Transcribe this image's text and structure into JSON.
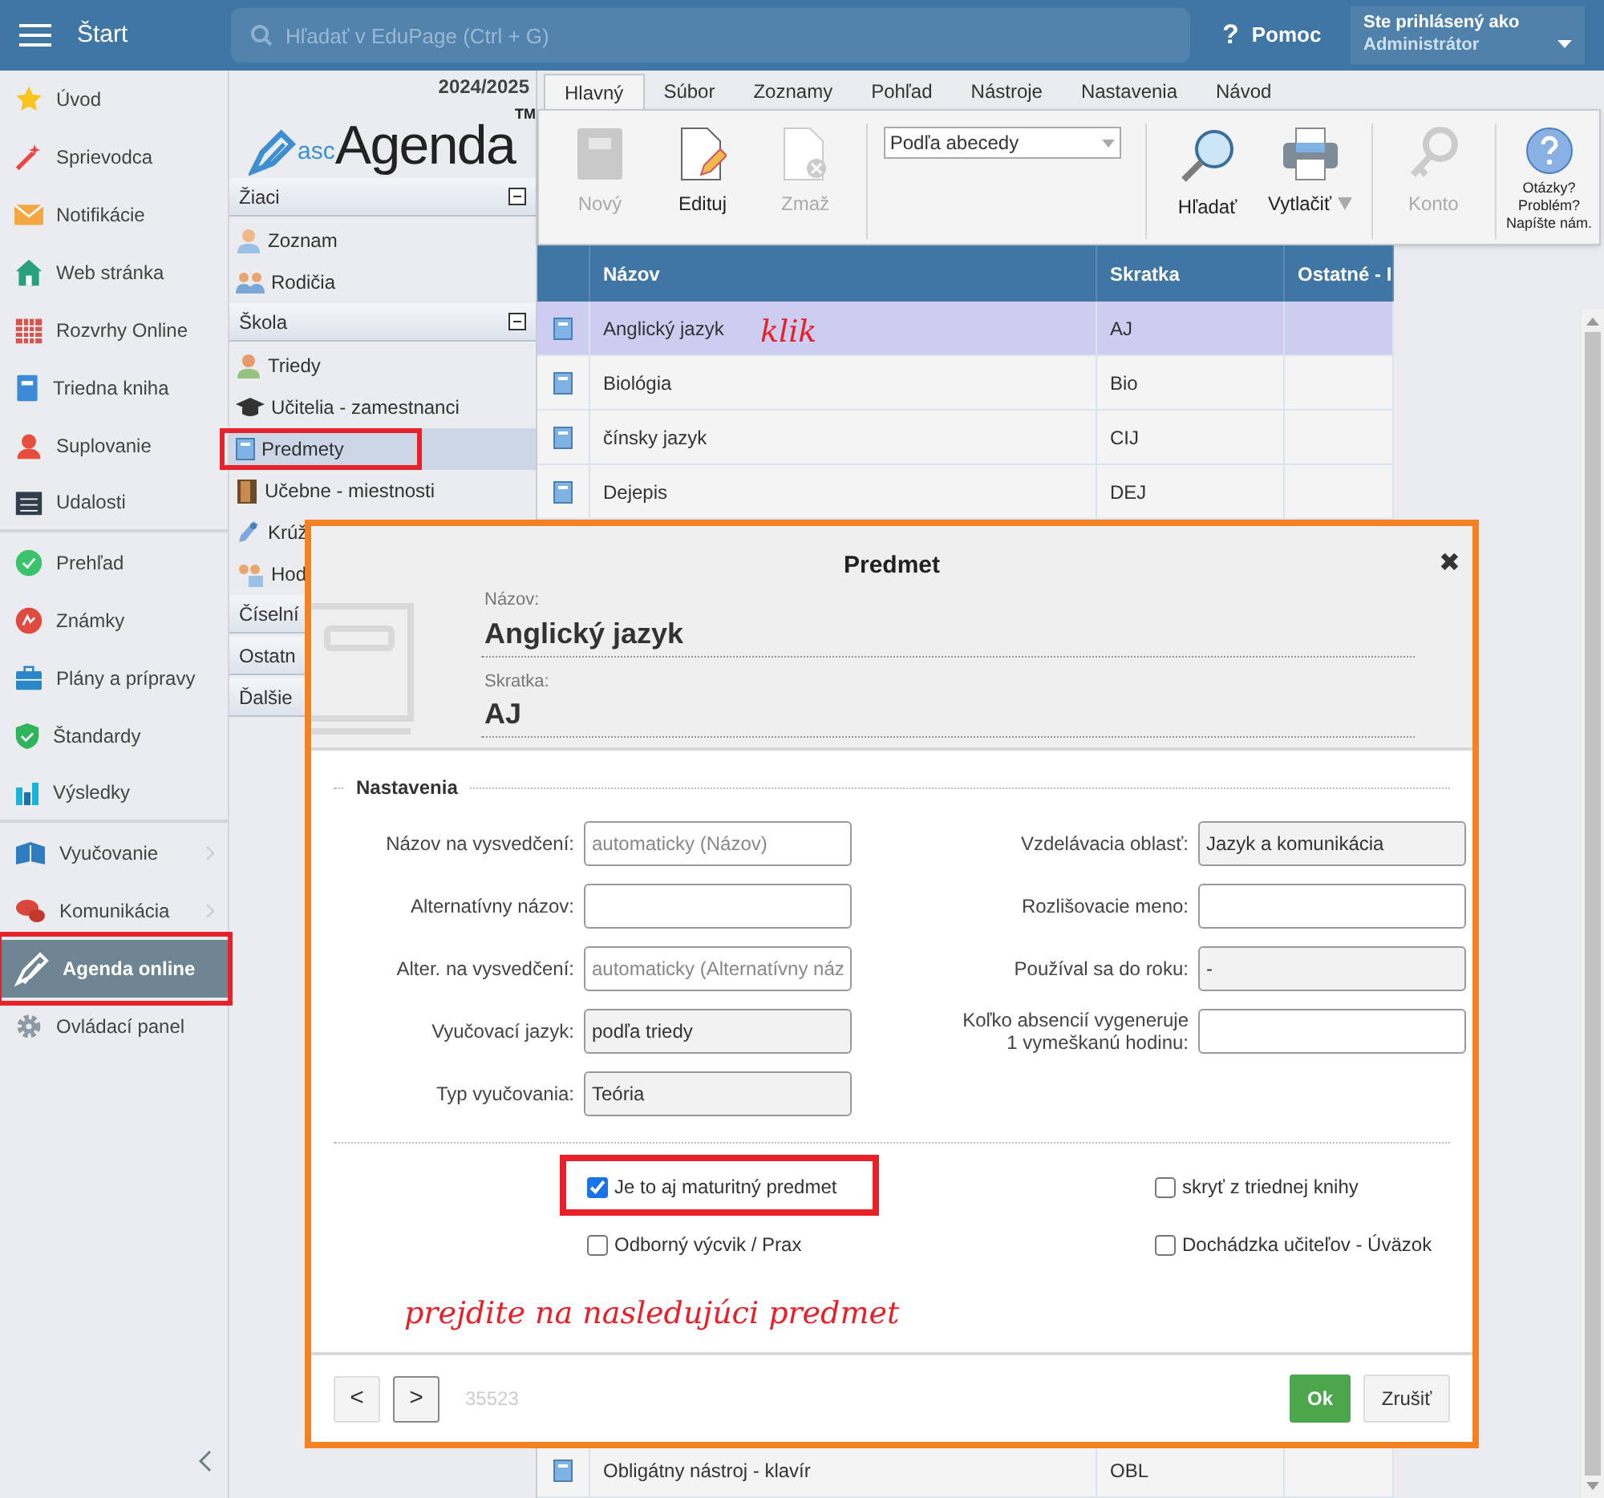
{
  "topbar": {
    "title": "Štart",
    "search": {
      "placeholder": "Hľadať v EduPage (Ctrl + G)"
    },
    "help_icon": "?",
    "help": "Pomoc",
    "user": {
      "caption": "Ste prihlásený ako",
      "name": "Administrátor"
    }
  },
  "sidebar": {
    "items": [
      {
        "label": "Úvod",
        "selected": false,
        "submenu": false
      },
      {
        "label": "Sprievodca",
        "selected": false,
        "submenu": false
      },
      {
        "label": "Notifikácie",
        "selected": false,
        "submenu": false
      },
      {
        "label": "Web stránka",
        "selected": false,
        "submenu": false
      },
      {
        "label": "Rozvrhy Online",
        "selected": false,
        "submenu": false
      },
      {
        "label": "Triedna kniha",
        "selected": false,
        "submenu": false
      },
      {
        "label": "Suplovanie",
        "selected": false,
        "submenu": false
      },
      {
        "label": "Udalosti",
        "selected": false,
        "submenu": false,
        "divider_after": true
      },
      {
        "label": "Prehľad",
        "selected": false,
        "submenu": false
      },
      {
        "label": "Známky",
        "selected": false,
        "submenu": false
      },
      {
        "label": "Plány a prípravy",
        "selected": false,
        "submenu": false
      },
      {
        "label": "Štandardy",
        "selected": false,
        "submenu": false
      },
      {
        "label": "Výsledky",
        "selected": false,
        "submenu": false,
        "divider_after": true
      },
      {
        "label": "Vyučovanie",
        "selected": false,
        "submenu": true
      },
      {
        "label": "Komunikácia",
        "selected": false,
        "submenu": true
      },
      {
        "label": "Agenda online",
        "selected": true,
        "submenu": false,
        "highlighted": true
      },
      {
        "label": "Ovládací panel",
        "selected": false,
        "submenu": false
      }
    ]
  },
  "agenda_panel": {
    "year": "2024/2025",
    "logo": {
      "prefix": "asc",
      "name": "Agenda",
      "mark": "TM"
    },
    "sections": [
      {
        "label": "Žiaci",
        "expanded": true,
        "items": [
          {
            "label": "Zoznam",
            "selected": false
          },
          {
            "label": "Rodičia",
            "selected": false
          }
        ]
      },
      {
        "label": "Škola",
        "expanded": true,
        "items": [
          {
            "label": "Triedy",
            "selected": false
          },
          {
            "label": "Učitelia - zamestnanci",
            "selected": false
          },
          {
            "label": "Predmety",
            "selected": true,
            "highlighted": true
          },
          {
            "label": "Učebne - miestnosti",
            "selected": false
          },
          {
            "label": "Krúž",
            "selected": false
          },
          {
            "label": "Hod",
            "selected": false
          }
        ]
      },
      {
        "label": "Číselní",
        "expanded": false
      },
      {
        "label": "Ostatn",
        "expanded": false
      },
      {
        "label": "Ďalšie",
        "expanded": false
      }
    ]
  },
  "ribbon": {
    "tabs": [
      {
        "label": "Hlavný",
        "selected": true
      },
      {
        "label": "Súbor",
        "selected": false
      },
      {
        "label": "Zoznamy",
        "selected": false
      },
      {
        "label": "Pohľad",
        "selected": false
      },
      {
        "label": "Nástroje",
        "selected": false
      },
      {
        "label": "Nastavenia",
        "selected": false
      },
      {
        "label": "Návod",
        "selected": false
      }
    ],
    "buttons": [
      {
        "label": "Nový",
        "disabled": true,
        "kind": "new"
      },
      {
        "label": "Edituj",
        "disabled": false,
        "kind": "edit"
      },
      {
        "label": "Zmaž",
        "disabled": true,
        "kind": "delete"
      }
    ],
    "sort_select": "Podľa abecedy",
    "buttons2": [
      {
        "label": "Hľadať",
        "disabled": false,
        "kind": "search"
      },
      {
        "label": "Vytlačiť",
        "disabled": false,
        "kind": "print",
        "dropdown": true
      }
    ],
    "buttons3": [
      {
        "label": "Konto",
        "disabled": true,
        "kind": "key"
      }
    ],
    "help": "Otázky? Problém? Napíšte nám."
  },
  "table": {
    "columns": [
      "Názov",
      "Skratka",
      "Ostatné - I"
    ],
    "rows": [
      {
        "name": "Anglický jazyk",
        "abbr": "AJ",
        "selected": true
      },
      {
        "name": "Biológia",
        "abbr": "Bio",
        "selected": false
      },
      {
        "name": "čínsky jazyk",
        "abbr": "CIJ",
        "selected": false
      },
      {
        "name": "Dejepis",
        "abbr": "DEJ",
        "selected": false
      }
    ],
    "last_row": {
      "name": "Obligátny nástroj - klavír",
      "abbr": "OBL",
      "selected": false
    }
  },
  "annotations": {
    "click": "klik",
    "next": "prejdite na nasledujúci predmet"
  },
  "dialog": {
    "title": "Predmet",
    "close": "✖",
    "name_label": "Názov:",
    "name": "Anglický jazyk",
    "abbr_label": "Skratka:",
    "abbr": "AJ",
    "legend": "Nastavenia",
    "fields_left": [
      {
        "label": "Názov na vysvedčení:",
        "placeholder": "automaticky (Názov)",
        "readonly": false
      },
      {
        "label": "Alternatívny názov:",
        "readonly": false
      },
      {
        "label": "Alter. na vysvedčení:",
        "placeholder": "automaticky (Alternatívny náz",
        "readonly": false
      },
      {
        "label": "Vyučovací jazyk:",
        "value": "podľa triedy",
        "readonly": true
      },
      {
        "label": "Typ vyučovania:",
        "value": "Teória",
        "readonly": true
      }
    ],
    "fields_right": [
      {
        "label": "Vzdelávacia oblasť:",
        "value": "Jazyk a komunikácia",
        "readonly": true
      },
      {
        "label": "Rozlišovacie meno:",
        "readonly": false
      },
      {
        "label": "Používal sa do roku:",
        "value": "-",
        "readonly": true
      },
      {
        "label": "Koľko absencií vygeneruje 1 vymeškanú hodinu:",
        "readonly": false
      }
    ],
    "checkboxes_left": [
      {
        "label": "Je to aj maturitný predmet",
        "checked": true,
        "highlighted": true
      },
      {
        "label": "Odborný výcvik / Prax",
        "checked": false
      }
    ],
    "checkboxes_right": [
      {
        "label": "skryť z triednej knihy",
        "checked": false
      },
      {
        "label": "Dochádzka učiteľov - Úväzok",
        "checked": false
      }
    ],
    "prev": "<",
    "next": ">",
    "record_id": "35523",
    "ok": "Ok",
    "cancel": "Zrušiť"
  }
}
